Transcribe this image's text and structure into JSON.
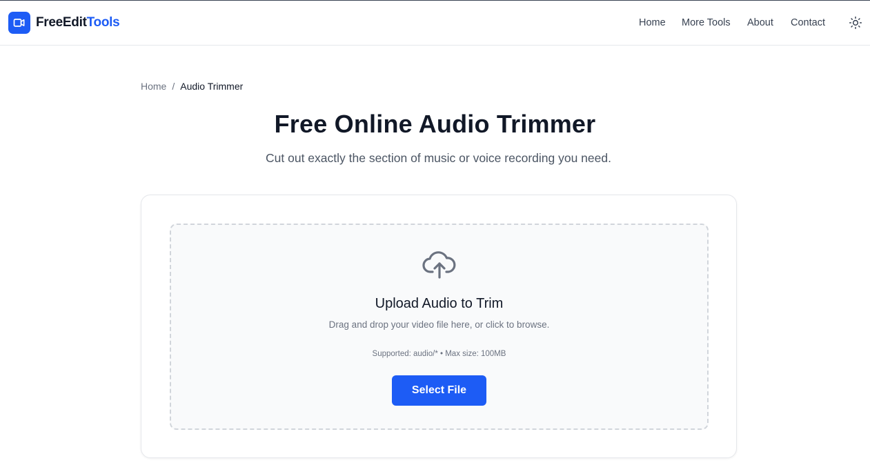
{
  "brand": {
    "name_part1": "FreeEdit",
    "name_part2": "Tools",
    "accent_color": "#1d5cf5",
    "icon": "video-camera-icon"
  },
  "nav": {
    "items": [
      {
        "label": "Home"
      },
      {
        "label": "More Tools"
      },
      {
        "label": "About"
      },
      {
        "label": "Contact"
      }
    ],
    "theme_toggle_icon": "sun-icon"
  },
  "breadcrumb": {
    "home": "Home",
    "separator": "/",
    "current": "Audio Trimmer"
  },
  "page": {
    "title": "Free Online Audio Trimmer",
    "subtitle": "Cut out exactly the section of music or voice recording you need."
  },
  "upload": {
    "icon": "cloud-upload-icon",
    "title": "Upload Audio to Trim",
    "description": "Drag and drop your video file here, or click to browse.",
    "supported": "Supported: audio/* • Max size: 100MB",
    "button_label": "Select File"
  }
}
